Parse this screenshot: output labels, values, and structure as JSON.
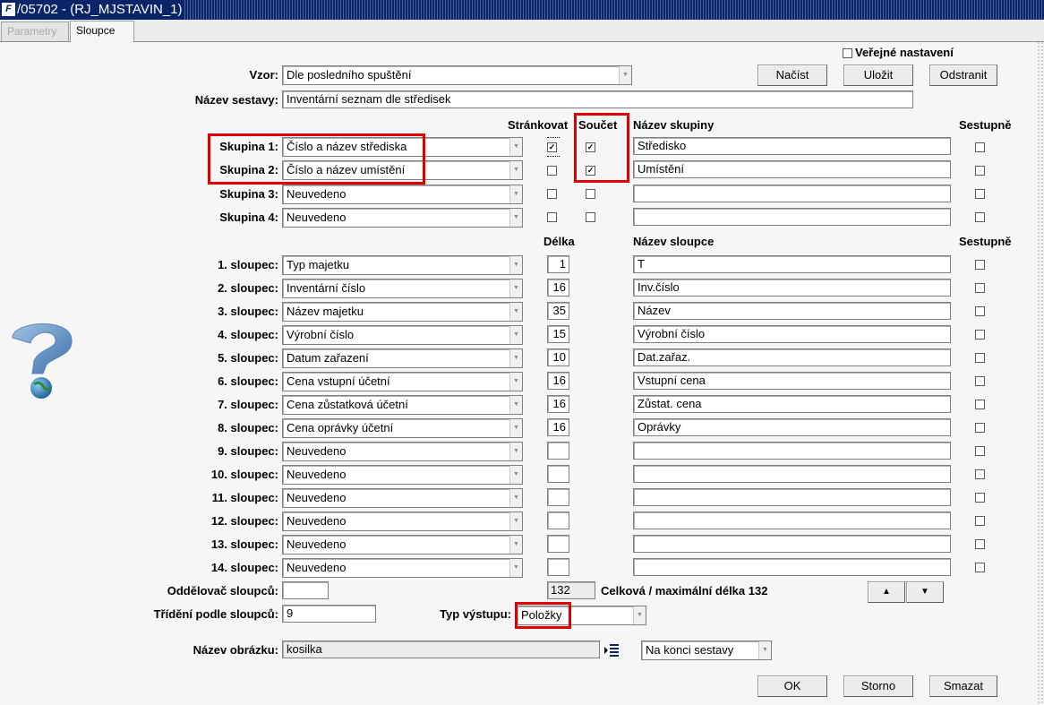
{
  "window": {
    "title": "/05702 - (RJ_MJSTAVIN_1)",
    "icon": "oracle-forms-icon"
  },
  "tabs": [
    {
      "label": "Parametry",
      "active": false
    },
    {
      "label": "Sloupce",
      "active": true
    }
  ],
  "public_settings": {
    "label": "Veřejné nastavení",
    "checked": false
  },
  "template": {
    "label": "Vzor:",
    "value": "Dle posledního spuštění"
  },
  "buttons_top": {
    "load": "Načíst",
    "save": "Uložit",
    "remove": "Odstranit"
  },
  "report_name": {
    "label": "Název sestavy:",
    "value": "Inventární seznam dle středisek"
  },
  "group_headers": {
    "paging": "Stránkovat",
    "sum": "Součet",
    "group_name": "Název skupiny",
    "descending": "Sestupně"
  },
  "groups": [
    {
      "label": "Skupina 1:",
      "value": "Číslo a název střediska",
      "paging": true,
      "sum": true,
      "name": "Středisko",
      "descending": false
    },
    {
      "label": "Skupina 2:",
      "value": "Číslo a název umístění",
      "paging": false,
      "sum": true,
      "name": "Umístění",
      "descending": false
    },
    {
      "label": "Skupina 3:",
      "value": "Neuvedeno",
      "paging": false,
      "sum": false,
      "name": "",
      "descending": false
    },
    {
      "label": "Skupina 4:",
      "value": "Neuvedeno",
      "paging": false,
      "sum": false,
      "name": "",
      "descending": false
    }
  ],
  "column_headers": {
    "length": "Délka",
    "column_name": "Název sloupce",
    "descending": "Sestupně"
  },
  "columns": [
    {
      "label": "1. sloupec:",
      "value": "Typ majetku",
      "length": "1",
      "name": "T"
    },
    {
      "label": "2. sloupec:",
      "value": "Inventární číslo",
      "length": "16",
      "name": "Inv.číslo"
    },
    {
      "label": "3. sloupec:",
      "value": "Název majetku",
      "length": "35",
      "name": "Název"
    },
    {
      "label": "4. sloupec:",
      "value": "Výrobní číslo",
      "length": "15",
      "name": "Výrobní číslo"
    },
    {
      "label": "5. sloupec:",
      "value": "Datum zařazení",
      "length": "10",
      "name": "Dat.zařaz."
    },
    {
      "label": "6. sloupec:",
      "value": "Cena vstupní účetní",
      "length": "16",
      "name": "Vstupní cena"
    },
    {
      "label": "7. sloupec:",
      "value": "Cena zůstatková účetní",
      "length": "16",
      "name": "Zůstat. cena"
    },
    {
      "label": "8. sloupec:",
      "value": "Cena oprávky účetní",
      "length": "16",
      "name": "Oprávky"
    },
    {
      "label": "9. sloupec:",
      "value": "Neuvedeno",
      "length": "",
      "name": ""
    },
    {
      "label": "10. sloupec:",
      "value": "Neuvedeno",
      "length": "",
      "name": ""
    },
    {
      "label": "11. sloupec:",
      "value": "Neuvedeno",
      "length": "",
      "name": ""
    },
    {
      "label": "12. sloupec:",
      "value": "Neuvedeno",
      "length": "",
      "name": ""
    },
    {
      "label": "13. sloupec:",
      "value": "Neuvedeno",
      "length": "",
      "name": ""
    },
    {
      "label": "14. sloupec:",
      "value": "Neuvedeno",
      "length": "",
      "name": ""
    }
  ],
  "separator": {
    "label": "Oddělovač sloupců:",
    "value": ""
  },
  "total_length": {
    "value": "132",
    "label": "Celková / maximální délka 132"
  },
  "sort": {
    "label": "Třídění podle sloupců:",
    "value": "9"
  },
  "output_type": {
    "label": "Typ výstupu:",
    "value": "Položky"
  },
  "image_name": {
    "label": "Název obrázku:",
    "value": "kosilka",
    "position": "Na konci sestavy"
  },
  "buttons_bottom": {
    "ok": "OK",
    "cancel": "Storno",
    "delete": "Smazat"
  },
  "icons": {
    "up": "▲",
    "down": "▼",
    "list": "list-picker-icon",
    "help": "help-question-icon"
  },
  "highlight_color": "#e00000"
}
